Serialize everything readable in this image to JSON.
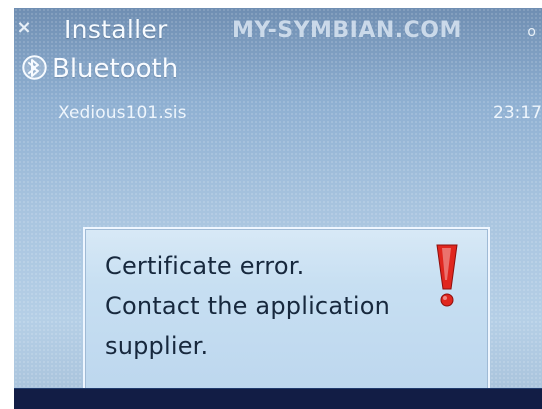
{
  "status_bar": {
    "title": "Installer",
    "watermark": "MY-SYMBIAN.COM",
    "signal_indicator": "o",
    "close_symbol": "×"
  },
  "context": {
    "title": "Bluetooth",
    "file_name": "Xedious101.sis",
    "time": "23:17"
  },
  "dialog": {
    "lines": [
      "Certificate error.",
      "Contact the application",
      "supplier."
    ]
  },
  "icons": {
    "close": "close-icon",
    "bluetooth": "bluetooth-icon",
    "warning": "exclamation-warning-icon"
  },
  "colors": {
    "screen_blue": "#8fb0d2",
    "dialog_blue": "#c7dff2",
    "warning_red": "#e0271f",
    "softkey_navy": "#121d45"
  }
}
